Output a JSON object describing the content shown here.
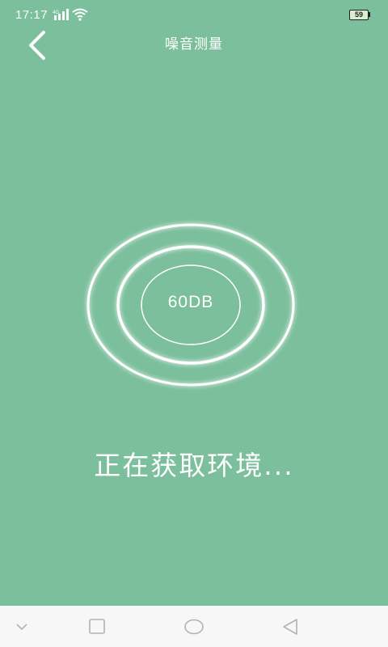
{
  "status_bar": {
    "time": "17:17",
    "network_type": "4G",
    "battery": "59"
  },
  "header": {
    "title": "噪音测量"
  },
  "meter": {
    "value": "60DB"
  },
  "status": {
    "message": "正在获取环境..."
  },
  "colors": {
    "background": "#7bbf9c",
    "foreground": "#ffffff",
    "nav_background": "#f7f7f7"
  }
}
